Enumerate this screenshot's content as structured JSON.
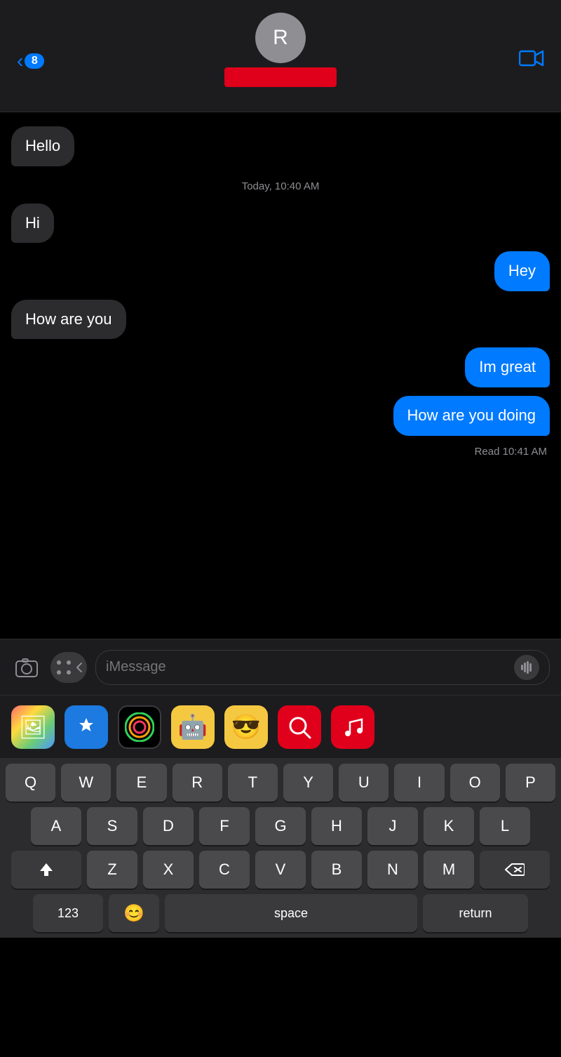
{
  "header": {
    "back_count": "8",
    "avatar_initial": "R",
    "video_call_label": "Video Call"
  },
  "messages": [
    {
      "id": 1,
      "type": "incoming",
      "text": "Hello"
    },
    {
      "id": 2,
      "type": "timestamp",
      "text": "Today, 10:40 AM"
    },
    {
      "id": 3,
      "type": "incoming",
      "text": "Hi"
    },
    {
      "id": 4,
      "type": "outgoing",
      "text": "Hey"
    },
    {
      "id": 5,
      "type": "incoming",
      "text": "How are you"
    },
    {
      "id": 6,
      "type": "outgoing",
      "text": "Im great"
    },
    {
      "id": 7,
      "type": "outgoing",
      "text": "How are you doing"
    }
  ],
  "read_receipt": "Read 10:41 AM",
  "input": {
    "placeholder": "iMessage"
  },
  "app_icons": [
    {
      "name": "Photos",
      "icon": "🖼"
    },
    {
      "name": "App Store",
      "icon": "🅰"
    },
    {
      "name": "Fitness",
      "icon": "🏃"
    },
    {
      "name": "Memoji",
      "icon": "🤖"
    },
    {
      "name": "Sticker",
      "icon": "😎"
    },
    {
      "name": "Web Search",
      "icon": "🔍"
    },
    {
      "name": "Music",
      "icon": "♪"
    }
  ],
  "keyboard": {
    "rows": [
      [
        "Q",
        "W",
        "E",
        "R",
        "T",
        "Y",
        "U",
        "I",
        "O",
        "P"
      ],
      [
        "A",
        "S",
        "D",
        "F",
        "G",
        "H",
        "J",
        "K",
        "L"
      ],
      [
        "Z",
        "X",
        "C",
        "V",
        "B",
        "N",
        "M"
      ]
    ],
    "space_label": "space",
    "return_label": "return",
    "num_label": "123"
  }
}
